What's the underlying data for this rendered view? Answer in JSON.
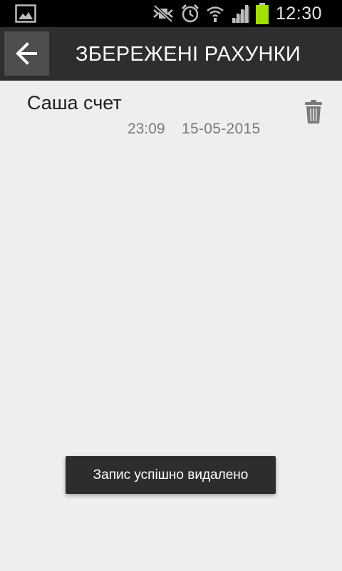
{
  "status_bar": {
    "time": "12:30",
    "icons": [
      "gallery-icon",
      "mute-icon",
      "alarm-icon",
      "wifi-icon",
      "signal-icon",
      "battery-icon"
    ],
    "battery_color": "#a3e000"
  },
  "action_bar": {
    "title": "ЗБЕРЕЖЕНІ РАХУНКИ",
    "back_icon": "back-arrow-icon",
    "background": "#2e2e2e"
  },
  "saved_accounts": [
    {
      "name": "Саша счет",
      "time": "23:09",
      "date": "15-05-2015",
      "delete_icon": "trash-icon"
    }
  ],
  "toast": {
    "message": "Запис успішно видалено"
  }
}
